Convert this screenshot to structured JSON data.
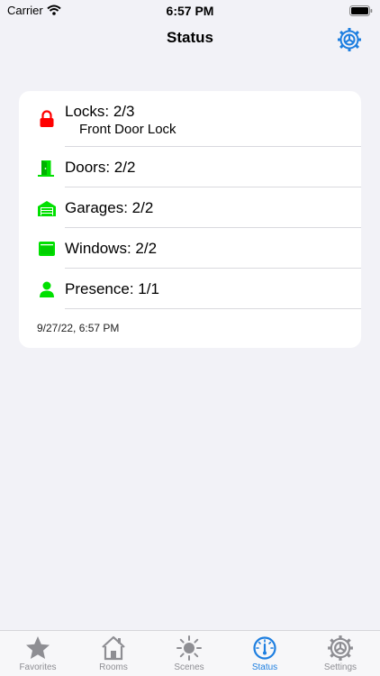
{
  "status_bar": {
    "carrier": "Carrier",
    "time": "6:57 PM"
  },
  "nav": {
    "title": "Status",
    "right_icon": "gear-icon"
  },
  "status": {
    "rows": [
      {
        "label": "Locks: 2/3",
        "detail": "Front Door Lock",
        "icon": "lock-icon",
        "color": "#ff0000"
      },
      {
        "label": "Doors: 2/2",
        "icon": "door-icon",
        "color": "#00e000"
      },
      {
        "label": "Garages: 2/2",
        "icon": "garage-icon",
        "color": "#00e000"
      },
      {
        "label": "Windows: 2/2",
        "icon": "window-icon",
        "color": "#00e000"
      },
      {
        "label": "Presence: 1/1",
        "icon": "person-icon",
        "color": "#00e000"
      }
    ],
    "timestamp": "9/27/22, 6:57 PM"
  },
  "tabs": [
    {
      "label": "Favorites",
      "icon": "star-icon",
      "active": false
    },
    {
      "label": "Rooms",
      "icon": "house-icon",
      "active": false
    },
    {
      "label": "Scenes",
      "icon": "sun-icon",
      "active": false
    },
    {
      "label": "Status",
      "icon": "gauge-icon",
      "active": true
    },
    {
      "label": "Settings",
      "icon": "gear-icon",
      "active": false
    }
  ],
  "colors": {
    "accent": "#1e7fe0",
    "ok": "#00e000",
    "alert": "#ff0000",
    "inactive": "#8e8e93",
    "background": "#f2f2f7"
  }
}
